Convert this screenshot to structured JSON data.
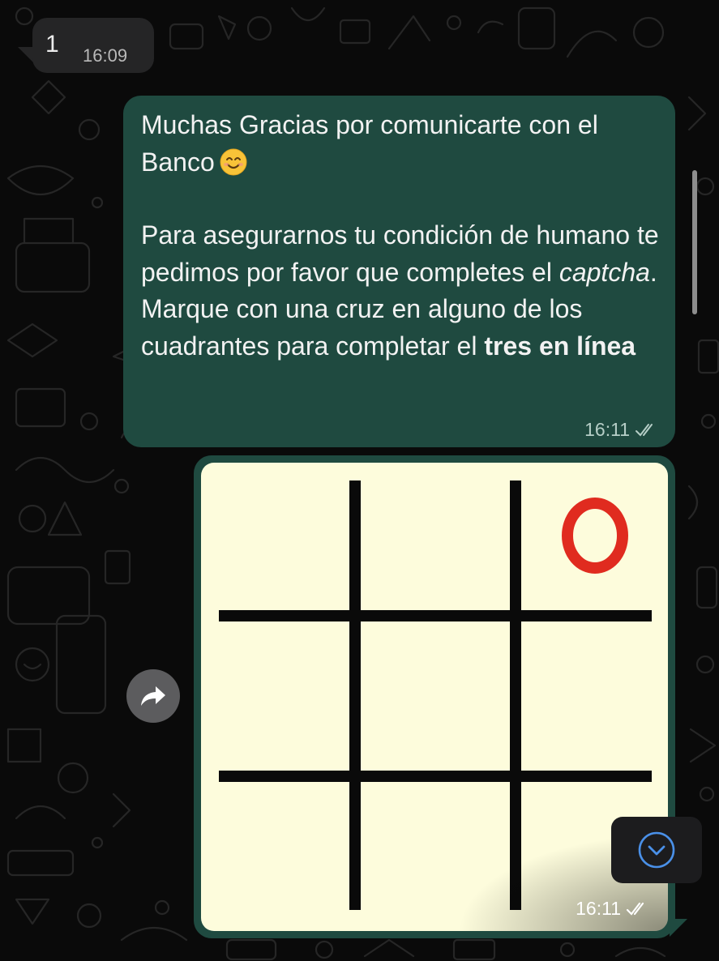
{
  "incoming_message": {
    "text": "1",
    "time": "16:09"
  },
  "outgoing_message": {
    "line1": "Muchas Gracias por comunicarte con el",
    "line2": "Banco",
    "emoji": "smiling-face-emoji",
    "para2_part1": "Para asegurarnos tu condición de humano te pedimos por favor que completes el ",
    "para2_italic": "captcha",
    "para2_part2": ".",
    "para3_part1": "Marque con una cruz en alguno de los cuadrantes para completar el ",
    "para3_bold": "tres en línea",
    "time": "16:11",
    "status": "double-check-icon"
  },
  "image_message": {
    "board": [
      [
        "",
        "",
        "O"
      ],
      [
        "",
        "",
        ""
      ],
      [
        "",
        "",
        ""
      ]
    ],
    "mark_color": "#e02b1f",
    "time": "16:11",
    "status": "double-check-icon"
  },
  "controls": {
    "forward": "forward-arrow-icon",
    "scroll_down": "chevron-down-circle-icon"
  },
  "colors": {
    "outgoing_bubble": "#1f4a40",
    "incoming_bubble": "#252526",
    "background": "#0a0a0a",
    "image_bg": "#fdfcdc"
  }
}
